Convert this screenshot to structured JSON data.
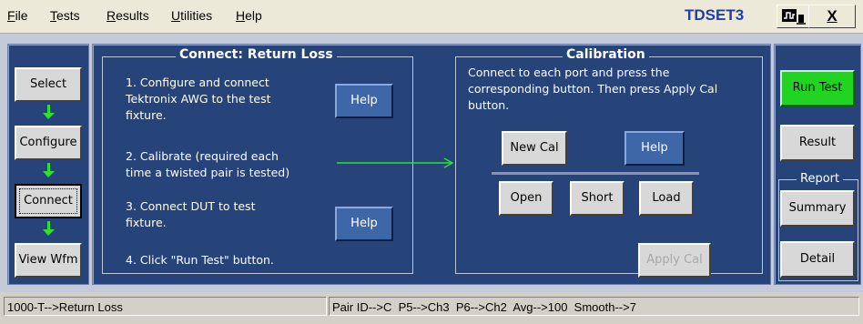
{
  "menu": {
    "items": [
      {
        "label": "File",
        "accel": "F",
        "rest": "ile"
      },
      {
        "label": "Tests",
        "accel": "T",
        "rest": "ests"
      },
      {
        "label": "Results",
        "accel": "R",
        "rest": "esults"
      },
      {
        "label": "Utilities",
        "accel": "U",
        "rest": "tilities"
      },
      {
        "label": "Help",
        "accel": "H",
        "rest": "elp"
      }
    ]
  },
  "app_title": "TDSET3",
  "close_label": "X",
  "nav": {
    "select": "Select",
    "configure": "Configure",
    "connect": "Connect",
    "view_wfm": "View Wfm",
    "selected": "Connect"
  },
  "connect_group": {
    "title": "Connect: Return Loss",
    "step1": "1. Configure and connect\nTektronix AWG to the test\nfixture.",
    "step2": "2. Calibrate (required each\ntime a twisted pair is tested)",
    "step3": "3. Connect DUT to test\nfixture.",
    "step4": "4. Click \"Run Test\" button.",
    "help1": "Help",
    "help2": "Help"
  },
  "calibration_group": {
    "title": "Calibration",
    "instructions": "Connect to each port and press the corresponding button. Then press Apply Cal button.",
    "new_cal": "New Cal",
    "help": "Help",
    "open": "Open",
    "short": "Short",
    "load": "Load",
    "apply_cal": "Apply Cal"
  },
  "right": {
    "run_test": "Run Test",
    "result": "Result",
    "report_title": "Report",
    "summary": "Summary",
    "detail": "Detail"
  },
  "colors": {
    "panel_bg": "#26447a",
    "run_test": "#22d422",
    "flow_arrow": "#2fe02f",
    "title": "#1a3fb0"
  },
  "status": {
    "left": "1000-T-->Return Loss",
    "right": "Pair ID-->C  P5-->Ch3  P6-->Ch2  Avg-->100  Smooth-->7"
  }
}
